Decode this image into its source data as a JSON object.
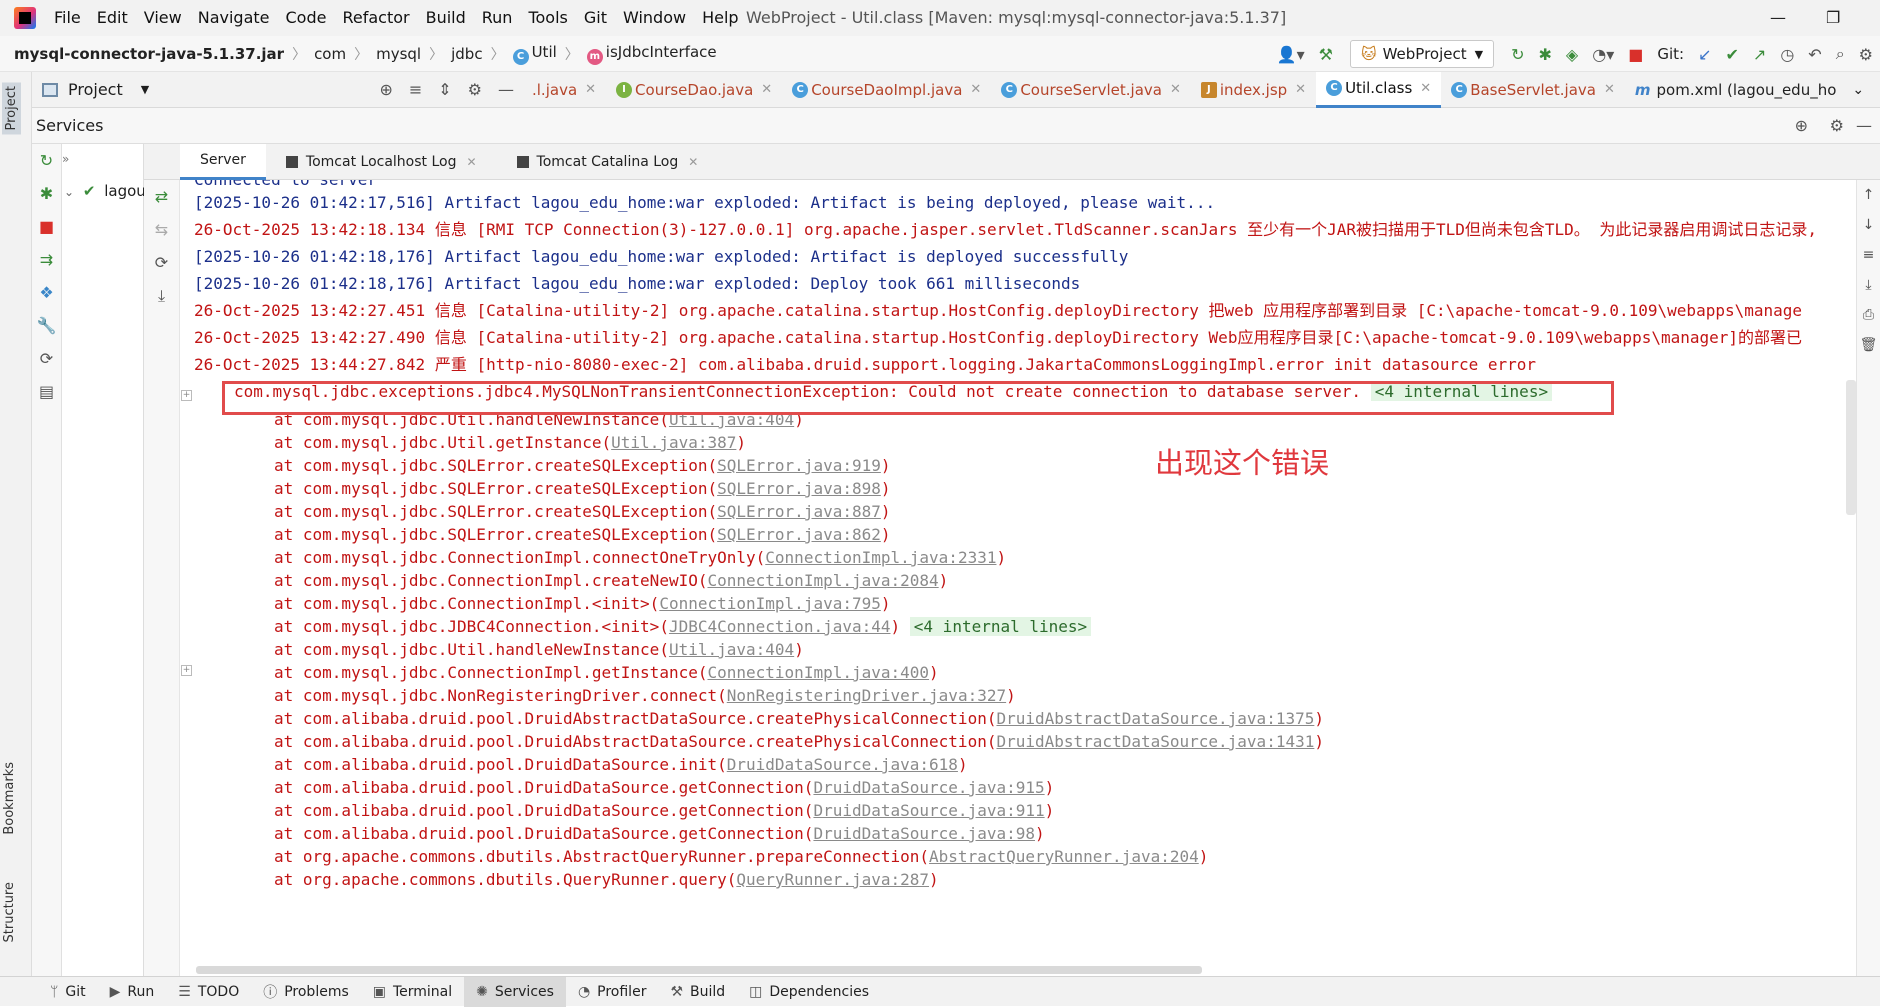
{
  "menubar": {
    "items": [
      "File",
      "Edit",
      "View",
      "Navigate",
      "Code",
      "Refactor",
      "Build",
      "Run",
      "Tools",
      "Git",
      "Window",
      "Help"
    ],
    "window_title": "WebProject - Util.class [Maven: mysql:mysql-connector-java:5.1.37]"
  },
  "navbar": {
    "jar": "mysql-connector-java-5.1.37.jar",
    "crumbs": [
      "com",
      "mysql",
      "jdbc"
    ],
    "class_name": "Util",
    "method_name": "isJdbcInterface",
    "run_config": "WebProject",
    "git_label": "Git:"
  },
  "project_panel": {
    "title": "Project"
  },
  "editor_tabs": [
    {
      "label": ".l.java"
    },
    {
      "label": "CourseDao.java"
    },
    {
      "label": "CourseDaoImpl.java"
    },
    {
      "label": "CourseServlet.java"
    },
    {
      "label": "index.jsp"
    },
    {
      "label": "Util.class"
    },
    {
      "label": "BaseServlet.java"
    },
    {
      "label": "pom.xml (lagou_edu_ho"
    }
  ],
  "sidebar_labels": {
    "project": "Project",
    "bookmarks": "Bookmarks",
    "structure": "Structure"
  },
  "services": {
    "title": "Services",
    "tree_item": "lagou",
    "log_tabs": [
      "Server",
      "Tomcat Localhost Log",
      "Tomcat Catalina Log"
    ]
  },
  "console": {
    "cut_line": "Connected to server",
    "l1": "[2025-10-26 01:42:17,516] Artifact lagou_edu_home:war exploded: Artifact is being deployed, please wait...",
    "l2": "26-Oct-2025 13:42:18.134 信息 [RMI TCP Connection(3)-127.0.0.1] org.apache.jasper.servlet.TldScanner.scanJars 至少有一个JAR被扫描用于TLD但尚未包含TLD。 为此记录器启用调试日志记录,",
    "l3": "[2025-10-26 01:42:18,176] Artifact lagou_edu_home:war exploded: Artifact is deployed successfully",
    "l4": "[2025-10-26 01:42:18,176] Artifact lagou_edu_home:war exploded: Deploy took 661 milliseconds",
    "l5": "26-Oct-2025 13:42:27.451 信息 [Catalina-utility-2] org.apache.catalina.startup.HostConfig.deployDirectory 把web 应用程序部署到目录 [C:\\apache-tomcat-9.0.109\\webapps\\manage",
    "l6": "26-Oct-2025 13:42:27.490 信息 [Catalina-utility-2] org.apache.catalina.startup.HostConfig.deployDirectory Web应用程序目录[C:\\apache-tomcat-9.0.109\\webapps\\manager]的部署已",
    "l7": "26-Oct-2025 13:44:27.842 严重 [http-nio-8080-exec-2] com.alibaba.druid.support.logging.JakartaCommonsLoggingImpl.error init datasource error",
    "exception": "com.mysql.jdbc.exceptions.jdbc4.MySQLNonTransientConnectionException: Could not create connection to database server.",
    "internal_lines": "<4 internal lines>",
    "annotation": "出现这个错误",
    "stack": [
      {
        "m": "at com.mysql.jdbc.Util.handleNewInstance(",
        "l": "Util.java:404",
        "e": ")"
      },
      {
        "m": "at com.mysql.jdbc.Util.getInstance(",
        "l": "Util.java:387",
        "e": ")"
      },
      {
        "m": "at com.mysql.jdbc.SQLError.createSQLException(",
        "l": "SQLError.java:919",
        "e": ")"
      },
      {
        "m": "at com.mysql.jdbc.SQLError.createSQLException(",
        "l": "SQLError.java:898",
        "e": ")"
      },
      {
        "m": "at com.mysql.jdbc.SQLError.createSQLException(",
        "l": "SQLError.java:887",
        "e": ")"
      },
      {
        "m": "at com.mysql.jdbc.SQLError.createSQLException(",
        "l": "SQLError.java:862",
        "e": ")"
      },
      {
        "m": "at com.mysql.jdbc.ConnectionImpl.connectOneTryOnly(",
        "l": "ConnectionImpl.java:2331",
        "e": ")"
      },
      {
        "m": "at com.mysql.jdbc.ConnectionImpl.createNewIO(",
        "l": "ConnectionImpl.java:2084",
        "e": ")"
      },
      {
        "m": "at com.mysql.jdbc.ConnectionImpl.<init>(",
        "l": "ConnectionImpl.java:795",
        "e": ")"
      },
      {
        "m": "at com.mysql.jdbc.JDBC4Connection.<init>(",
        "l": "JDBC4Connection.java:44",
        "e": ") "
      },
      {
        "m": "at com.mysql.jdbc.Util.handleNewInstance(",
        "l": "Util.java:404",
        "e": ")"
      },
      {
        "m": "at com.mysql.jdbc.ConnectionImpl.getInstance(",
        "l": "ConnectionImpl.java:400",
        "e": ")"
      },
      {
        "m": "at com.mysql.jdbc.NonRegisteringDriver.connect(",
        "l": "NonRegisteringDriver.java:327",
        "e": ")"
      },
      {
        "m": "at com.alibaba.druid.pool.DruidAbstractDataSource.createPhysicalConnection(",
        "l": "DruidAbstractDataSource.java:1375",
        "e": ")"
      },
      {
        "m": "at com.alibaba.druid.pool.DruidAbstractDataSource.createPhysicalConnection(",
        "l": "DruidAbstractDataSource.java:1431",
        "e": ")"
      },
      {
        "m": "at com.alibaba.druid.pool.DruidDataSource.init(",
        "l": "DruidDataSource.java:618",
        "e": ")"
      },
      {
        "m": "at com.alibaba.druid.pool.DruidDataSource.getConnection(",
        "l": "DruidDataSource.java:915",
        "e": ")"
      },
      {
        "m": "at com.alibaba.druid.pool.DruidDataSource.getConnection(",
        "l": "DruidDataSource.java:911",
        "e": ")"
      },
      {
        "m": "at com.alibaba.druid.pool.DruidDataSource.getConnection(",
        "l": "DruidDataSource.java:98",
        "e": ")"
      },
      {
        "m": "at org.apache.commons.dbutils.AbstractQueryRunner.prepareConnection(",
        "l": "AbstractQueryRunner.java:204",
        "e": ")"
      },
      {
        "m": "at org.apache.commons.dbutils.QueryRunner.query(",
        "l": "QueryRunner.java:287",
        "e": ")"
      }
    ]
  },
  "statusbar": [
    "Git",
    "Run",
    "TODO",
    "Problems",
    "Terminal",
    "Services",
    "Profiler",
    "Build",
    "Dependencies"
  ],
  "colors": {
    "accent": "#4083c9",
    "error_red": "#c11414",
    "info_blue": "#1b2f8a",
    "highlight_box": "#e14b4b"
  }
}
